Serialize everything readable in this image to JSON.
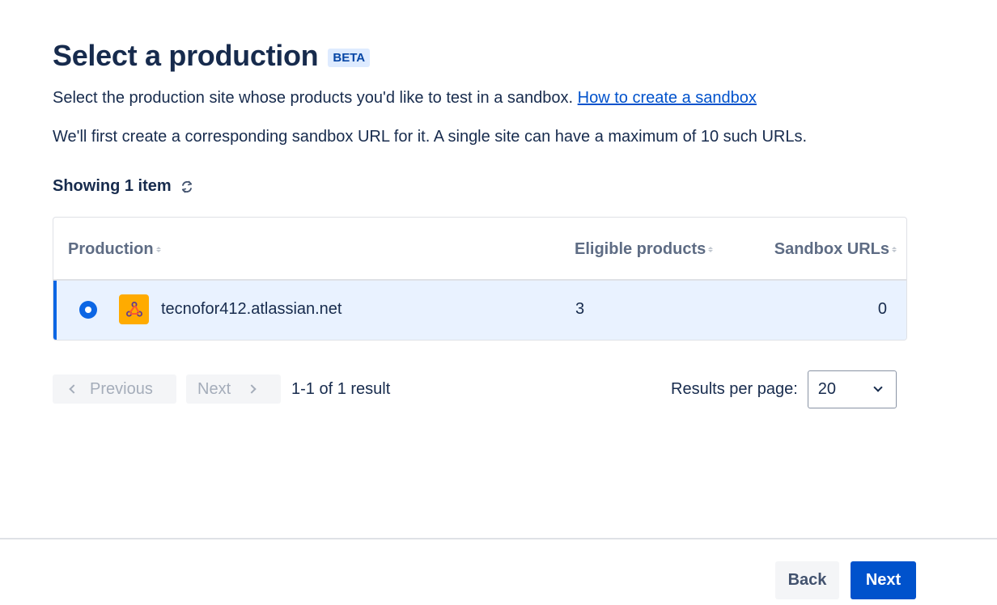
{
  "header": {
    "title": "Select a production",
    "badge": "BETA"
  },
  "description": {
    "line1_text": "Select the production site whose products you'd like to test in a sandbox. ",
    "line1_link": "How to create a sandbox",
    "line2": "We'll first create a corresponding sandbox URL for it. A single site can have a maximum of 10 such URLs."
  },
  "listing": {
    "showing": "Showing 1 item",
    "refresh_icon": "refresh-icon"
  },
  "table": {
    "columns": [
      "Production",
      "Eligible products",
      "Sandbox URLs"
    ],
    "rows": [
      {
        "selected": true,
        "site": "tecnofor412.atlassian.net",
        "eligible_products": "3",
        "sandbox_urls": "0",
        "icon": "site-icon"
      }
    ]
  },
  "pagination": {
    "previous_label": "Previous",
    "next_label": "Next",
    "range_text": "1-1 of 1 result",
    "results_per_page_label": "Results per page:",
    "results_per_page_value": "20"
  },
  "footer": {
    "back_label": "Back",
    "next_label": "Next"
  },
  "colors": {
    "primary": "#0052cc",
    "selected_row": "#e9f2ff",
    "site_icon_bg": "#ffab00"
  }
}
